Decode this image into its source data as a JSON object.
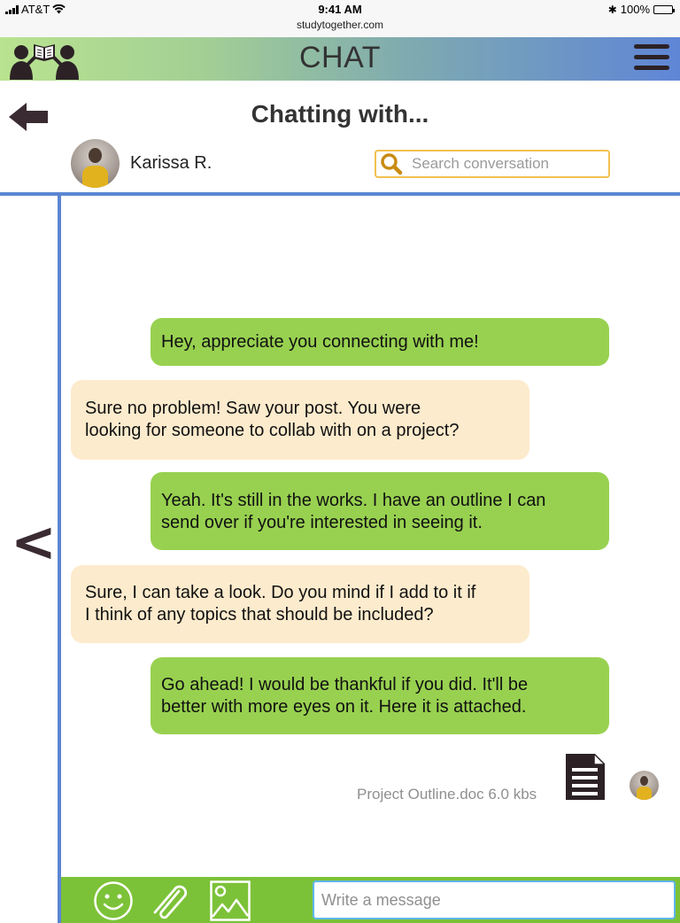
{
  "status_bar": {
    "carrier": "AT&T",
    "time": "9:41 AM",
    "url": "studytogether.com",
    "battery": "100%"
  },
  "header": {
    "title": "CHAT",
    "logo_icon": "two-readers-book-icon",
    "menu_icon": "hamburger-menu-icon"
  },
  "chat": {
    "title": "Chatting with...",
    "contact_name": "Karissa R.",
    "search_placeholder": "Search conversation"
  },
  "messages": [
    {
      "from": "me",
      "lines": [
        "Hey, appreciate you connecting with me!"
      ]
    },
    {
      "from": "them",
      "lines": [
        "Sure no problem! Saw your post. You were",
        "looking for someone to collab with on a project?"
      ]
    },
    {
      "from": "me",
      "lines": [
        "Yeah. It's still in the works. I have an outline I can",
        "send over if you're interested in seeing it."
      ]
    },
    {
      "from": "them",
      "lines": [
        "Sure, I can take a look. Do you mind if I add to it if",
        "I think of any topics that should be included?"
      ]
    },
    {
      "from": "me",
      "lines": [
        "Go ahead! I would be thankful if you did. It'll be",
        "better with more eyes on it. Here it is attached."
      ]
    }
  ],
  "attachment": {
    "label": "Project Outline.doc 6.0 kbs",
    "icon": "document-icon"
  },
  "composer": {
    "placeholder": "Write a message",
    "icons": [
      "smiley-icon",
      "paperclip-icon",
      "image-icon"
    ]
  },
  "colors": {
    "accent_blue": "#5b86d3",
    "sent_bubble": "#98d150",
    "received_bubble": "#fdebcd",
    "composer_bar": "#7cc238",
    "search_border": "#f2c14e"
  }
}
